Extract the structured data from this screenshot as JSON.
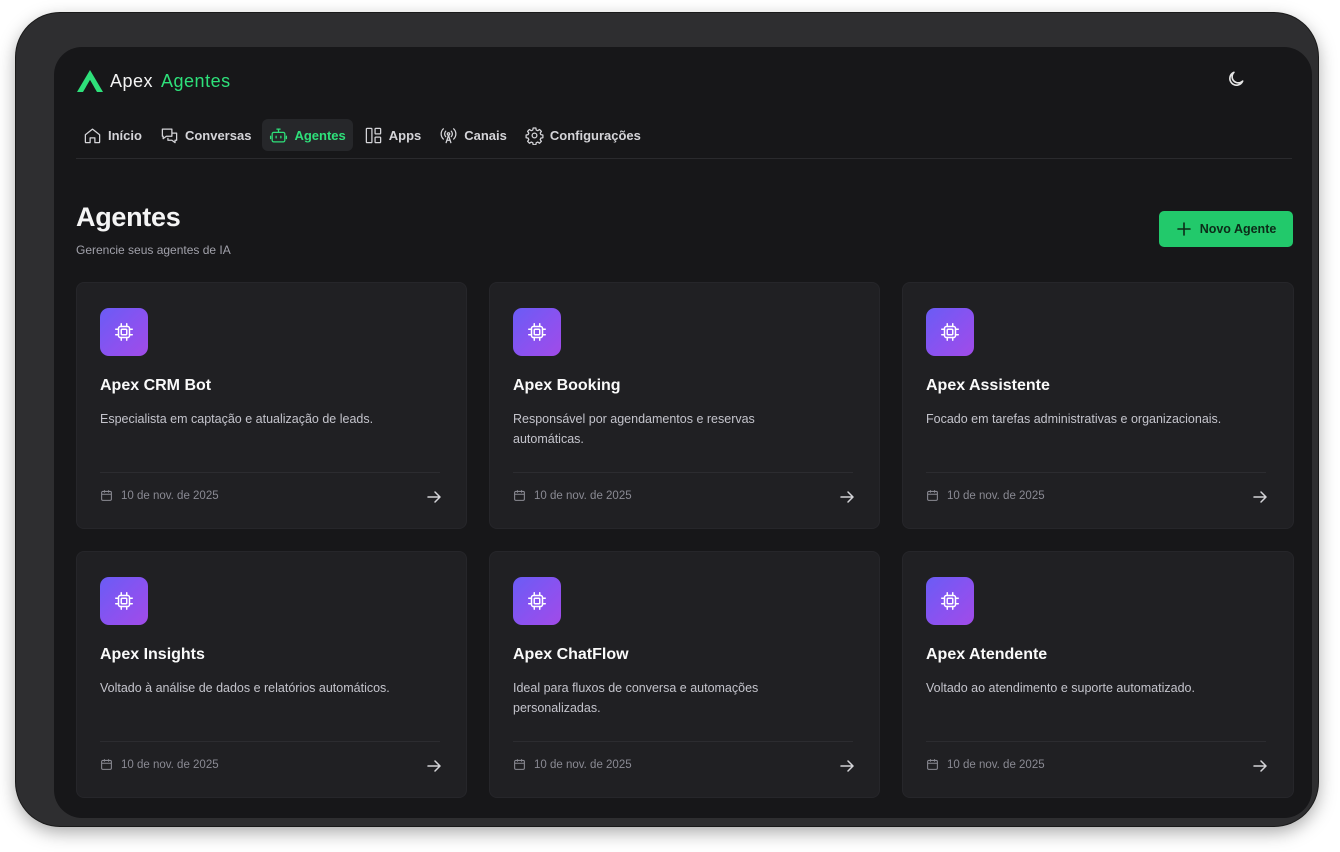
{
  "app": {
    "brand": "Apex",
    "brand_accent": "Agentes"
  },
  "colors": {
    "accent": "#2ee07a",
    "button_bg": "#22c96b",
    "background": "#171719",
    "card_bg": "#202023",
    "icon_gradient": [
      "#6a5cf5",
      "#a14be8"
    ]
  },
  "nav": {
    "items": [
      {
        "label": "Início",
        "icon": "home-icon"
      },
      {
        "label": "Conversas",
        "icon": "chat-icon"
      },
      {
        "label": "Agentes",
        "icon": "bot-icon",
        "active": true
      },
      {
        "label": "Apps",
        "icon": "apps-icon"
      },
      {
        "label": "Canais",
        "icon": "antenna-icon"
      },
      {
        "label": "Configurações",
        "icon": "gear-icon"
      }
    ]
  },
  "theme_toggle": {
    "icon": "moon-icon"
  },
  "page": {
    "title": "Agentes",
    "subtitle": "Gerencie seus agentes de IA",
    "new_button": "Novo Agente"
  },
  "agents": [
    {
      "name": "Apex CRM Bot",
      "description": "Especialista em captação e atualização de leads.",
      "date": "10 de nov. de 2025"
    },
    {
      "name": "Apex Booking",
      "description": "Responsável por agendamentos e reservas automáticas.",
      "date": "10 de nov. de 2025"
    },
    {
      "name": "Apex Assistente",
      "description": "Focado em tarefas administrativas e organizacionais.",
      "date": "10 de nov. de 2025"
    },
    {
      "name": "Apex Insights",
      "description": "Voltado à análise de dados e relatórios automáticos.",
      "date": "10 de nov. de 2025"
    },
    {
      "name": "Apex ChatFlow",
      "description": "Ideal para fluxos de conversa e automações personalizadas.",
      "date": "10 de nov. de 2025"
    },
    {
      "name": "Apex Atendente",
      "description": "Voltado ao atendimento e suporte automatizado.",
      "date": "10 de nov. de 2025"
    }
  ]
}
